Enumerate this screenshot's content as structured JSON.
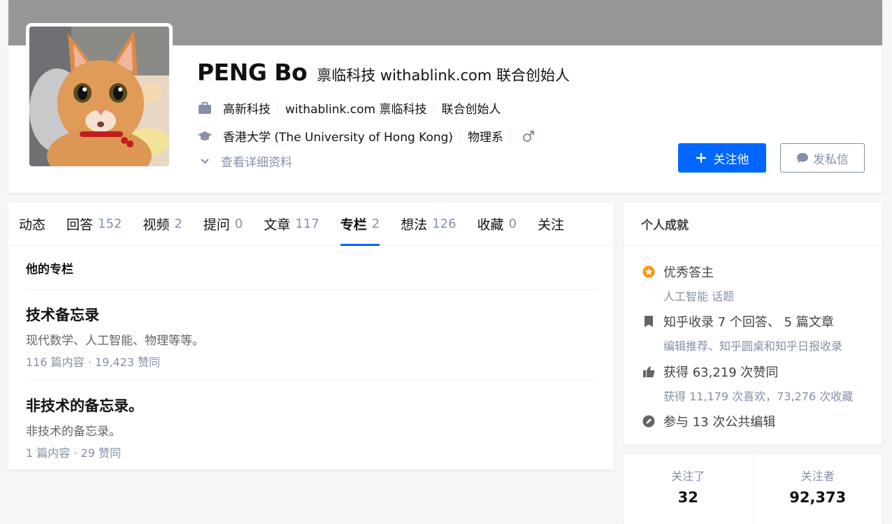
{
  "profile": {
    "name": "PENG Bo",
    "headline": "禀临科技 withablink.com 联合创始人",
    "work": [
      "高新科技",
      "withablink.com 禀临科技",
      "联合创始人"
    ],
    "education": [
      "香港大学 (The University of Hong Kong)",
      "物理系"
    ],
    "gender_icon": "male-icon",
    "more_label": "查看详细资料",
    "follow_label": "关注他",
    "message_label": "发私信"
  },
  "tabs": [
    {
      "label": "动态",
      "count": ""
    },
    {
      "label": "回答",
      "count": "152"
    },
    {
      "label": "视频",
      "count": "2"
    },
    {
      "label": "提问",
      "count": "0"
    },
    {
      "label": "文章",
      "count": "117"
    },
    {
      "label": "专栏",
      "count": "2"
    },
    {
      "label": "想法",
      "count": "126"
    },
    {
      "label": "收藏",
      "count": "0"
    },
    {
      "label": "关注",
      "count": ""
    }
  ],
  "active_tab": "专栏",
  "columns": {
    "section_title": "他的专栏",
    "items": [
      {
        "title": "技术备忘录",
        "desc": "现代数学、人工智能、物理等等。",
        "meta": "116 篇内容 · 19,423 赞同"
      },
      {
        "title": "非技术的备忘录。",
        "desc": "非技术的备忘录。",
        "meta": "1 篇内容 · 29 赞同"
      }
    ]
  },
  "achievements": {
    "title": "个人成就",
    "items": [
      {
        "icon": "excellent-answerer-icon",
        "main": "优秀答主",
        "sub": "人工智能 话题"
      },
      {
        "icon": "bookmark-icon",
        "main": "知乎收录 7 个回答、 5 篇文章",
        "sub": "编辑推荐、知乎圆桌和知乎日报收录"
      },
      {
        "icon": "thumbs-up-icon",
        "main": "获得 63,219 次赞同",
        "sub": "获得 11,179 次喜欢，73,276 次收藏"
      },
      {
        "icon": "edit-icon",
        "main": "参与 13 次公共编辑",
        "sub": ""
      }
    ]
  },
  "follow_stats": {
    "following_label": "关注了",
    "following_value": "32",
    "followers_label": "关注者",
    "followers_value": "92,373"
  },
  "colors": {
    "accent": "#0066ff",
    "muted": "#8590a6",
    "cover": "#969696",
    "badge": "#ff9607"
  }
}
